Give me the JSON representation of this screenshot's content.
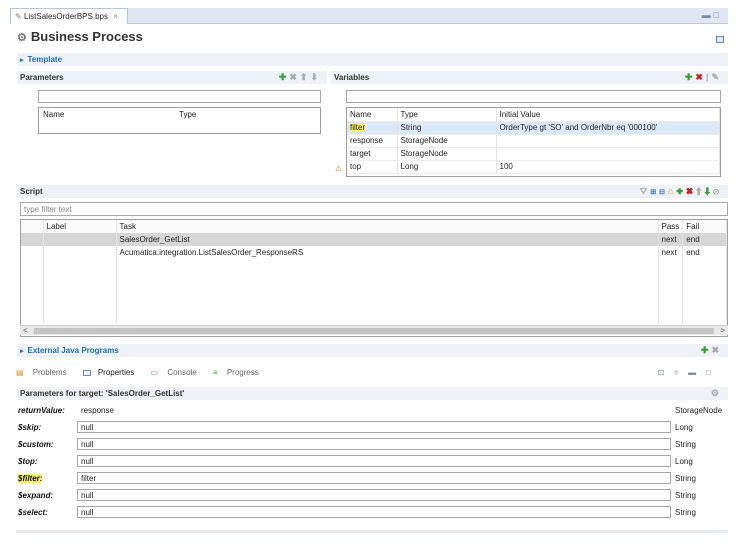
{
  "editor_tab": {
    "title": "ListSalesOrderBPS.bps",
    "close_icon": "×"
  },
  "header": {
    "title": "Business Process"
  },
  "template": {
    "label": "Template"
  },
  "parameters": {
    "title": "Parameters",
    "filter_value": "",
    "columns": [
      "Name",
      "Type"
    ]
  },
  "variables": {
    "title": "Variables",
    "filter_value": "",
    "columns": [
      "Name",
      "Type",
      "Initial Value"
    ],
    "rows": [
      {
        "name": "filter",
        "type": "String",
        "value": "OrderType gt 'SO' and OrderNbr eq '000100'"
      },
      {
        "name": "response",
        "type": "StorageNode",
        "value": ""
      },
      {
        "name": "target",
        "type": "StorageNode",
        "value": ""
      },
      {
        "name": "top",
        "type": "Long",
        "value": "100"
      }
    ]
  },
  "script": {
    "title": "Script",
    "filter_placeholder": "type filter text",
    "columns": [
      "Label",
      "Task",
      "Pass",
      "Fail"
    ],
    "rows": [
      {
        "label": "",
        "task": "SalesOrder_GetList",
        "pass": "next",
        "fail": "end"
      },
      {
        "label": "",
        "task": "Acumatica.integration.ListSalesOrder_ResponseRS",
        "pass": "next",
        "fail": "end"
      }
    ]
  },
  "external": {
    "label": "External Java Programs"
  },
  "view_tabs": {
    "problems": "Problems",
    "properties": "Properties",
    "console": "Console",
    "progress": "Progress"
  },
  "properties": {
    "title": "Parameters for target: 'SalesOrder_GetList'",
    "rows": [
      {
        "label": "returnValue:",
        "value": "response",
        "type": "StorageNode"
      },
      {
        "label": "$skip:",
        "value": "null",
        "type": "Long"
      },
      {
        "label": "$custom:",
        "value": "null",
        "type": "String"
      },
      {
        "label": "$top:",
        "value": "null",
        "type": "Long"
      },
      {
        "label": "$filter:",
        "value": "filter",
        "type": "String"
      },
      {
        "label": "$expand:",
        "value": "null",
        "type": "String"
      },
      {
        "label": "$select:",
        "value": "null",
        "type": "String"
      }
    ]
  },
  "colors": {
    "highlight": "#f5f26a",
    "link": "#1f6fb2",
    "add": "#3a9a3a",
    "delete": "#c0282d"
  }
}
